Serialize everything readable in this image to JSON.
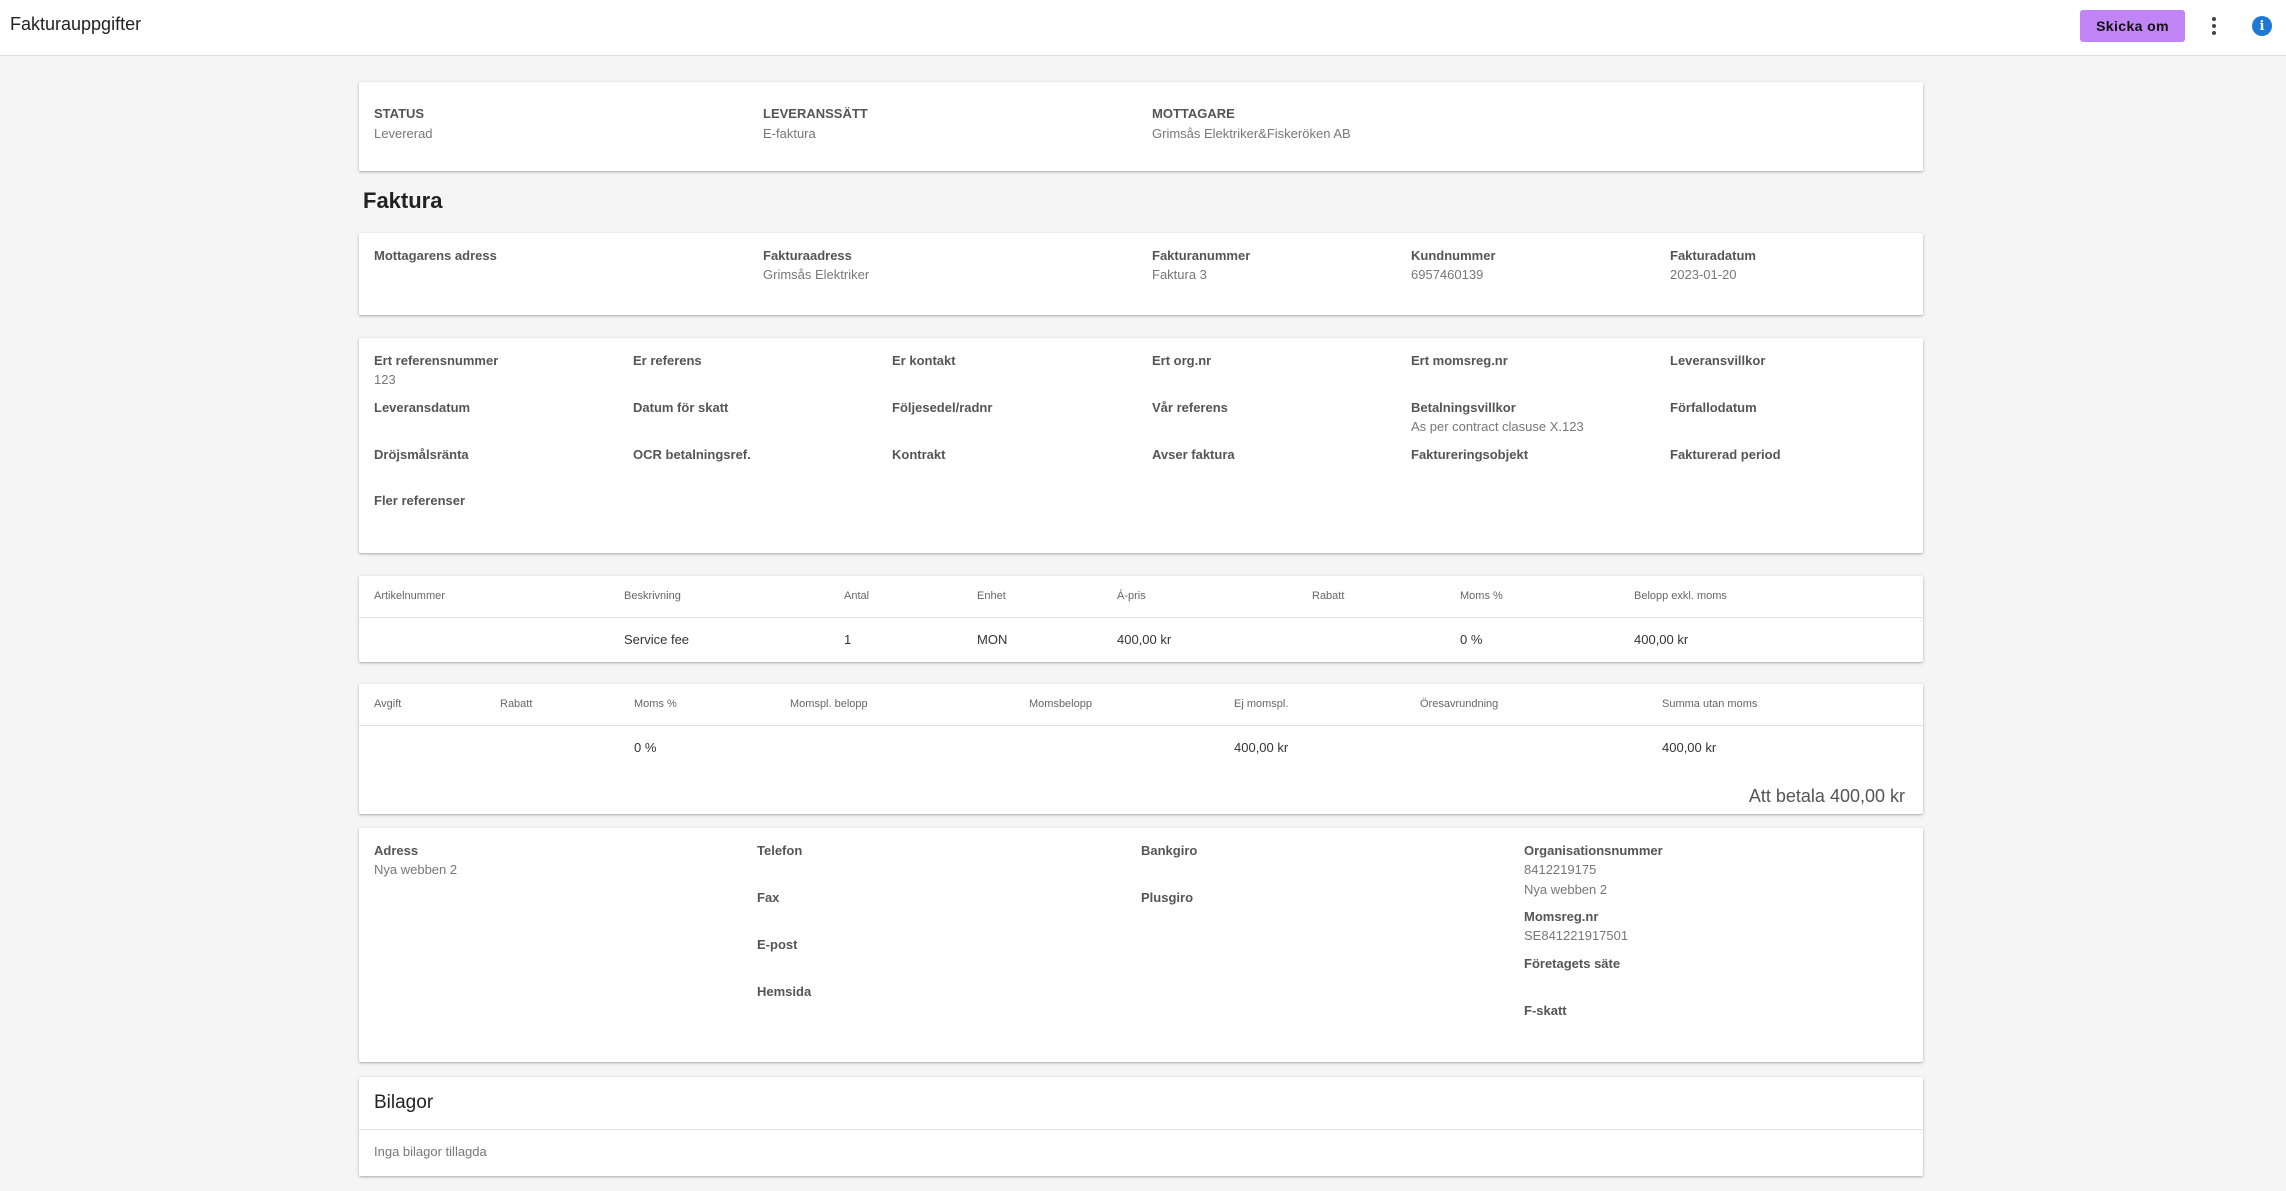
{
  "header": {
    "title": "Fakturauppgifter",
    "resend_label": "Skicka om",
    "info_glyph": "i"
  },
  "summary": {
    "status_label": "STATUS",
    "status_value": "Levererad",
    "delivery_label": "LEVERANSSÄTT",
    "delivery_value": "E-faktura",
    "recipient_label": "MOTTAGARE",
    "recipient_value": "Grimsås Elektriker&Fiskeröken AB"
  },
  "invoice_heading": "Faktura",
  "invoice_info": {
    "recipient_address_label": "Mottagarens adress",
    "invoice_address_label": "Fakturaadress",
    "invoice_address_value": "Grimsås Elektriker",
    "invoice_number_label": "Fakturanummer",
    "invoice_number_value": "Faktura 3",
    "customer_number_label": "Kundnummer",
    "customer_number_value": "6957460139",
    "invoice_date_label": "Fakturadatum",
    "invoice_date_value": "2023-01-20"
  },
  "references": {
    "row1": [
      {
        "label": "Ert referensnummer",
        "value": "123"
      },
      {
        "label": "Er referens",
        "value": ""
      },
      {
        "label": "Er kontakt",
        "value": ""
      },
      {
        "label": "Ert org.nr",
        "value": ""
      },
      {
        "label": "Ert momsreg.nr",
        "value": ""
      },
      {
        "label": "Leveransvillkor",
        "value": ""
      }
    ],
    "row2": [
      {
        "label": "Leveransdatum",
        "value": ""
      },
      {
        "label": "Datum för skatt",
        "value": ""
      },
      {
        "label": "Följesedel/radnr",
        "value": ""
      },
      {
        "label": "Vår referens",
        "value": ""
      },
      {
        "label": "Betalningsvillkor",
        "value": "As per contract clasuse X.123"
      },
      {
        "label": "Förfallodatum",
        "value": ""
      }
    ],
    "row3": [
      {
        "label": "Dröjsmålsränta",
        "value": ""
      },
      {
        "label": "OCR betalningsref.",
        "value": ""
      },
      {
        "label": "Kontrakt",
        "value": ""
      },
      {
        "label": "Avser faktura",
        "value": ""
      },
      {
        "label": "Faktureringsobjekt",
        "value": ""
      },
      {
        "label": "Fakturerad period",
        "value": ""
      }
    ],
    "row4": [
      {
        "label": "Fler referenser",
        "value": ""
      }
    ]
  },
  "items_table": {
    "headers": [
      "Artikelnummer",
      "Beskrivning",
      "Antal",
      "Enhet",
      "Á-pris",
      "Rabatt",
      "Moms %",
      "Belopp exkl. moms"
    ],
    "rows": [
      [
        "",
        "Service fee",
        "1",
        "MON",
        "400,00 kr",
        "",
        "0 %",
        "400,00 kr"
      ]
    ]
  },
  "totals_table": {
    "headers": [
      "Avgift",
      "Rabatt",
      "Moms %",
      "Momspl. belopp",
      "Momsbelopp",
      "Ej momspl.",
      "Öresavrundning",
      "Summa utan moms"
    ],
    "rows": [
      [
        "",
        "",
        "0 %",
        "",
        "",
        "400,00 kr",
        "",
        "400,00 kr"
      ]
    ],
    "total_text": "Att betala 400,00 kr"
  },
  "sender": {
    "address_label": "Adress",
    "address_value": "Nya webben 2",
    "phone_label": "Telefon",
    "fax_label": "Fax",
    "email_label": "E-post",
    "website_label": "Hemsida",
    "bankgiro_label": "Bankgiro",
    "plusgiro_label": "Plusgiro",
    "org_number_label": "Organisationsnummer",
    "org_number_value": "8412219175",
    "org_address_value": "Nya webben 2",
    "vat_label": "Momsreg.nr",
    "vat_value": "SE841221917501",
    "seat_label": "Företagets säte",
    "ftax_label": "F-skatt"
  },
  "attachments": {
    "title": "Bilagor",
    "empty_text": "Inga bilagor tillagda"
  }
}
